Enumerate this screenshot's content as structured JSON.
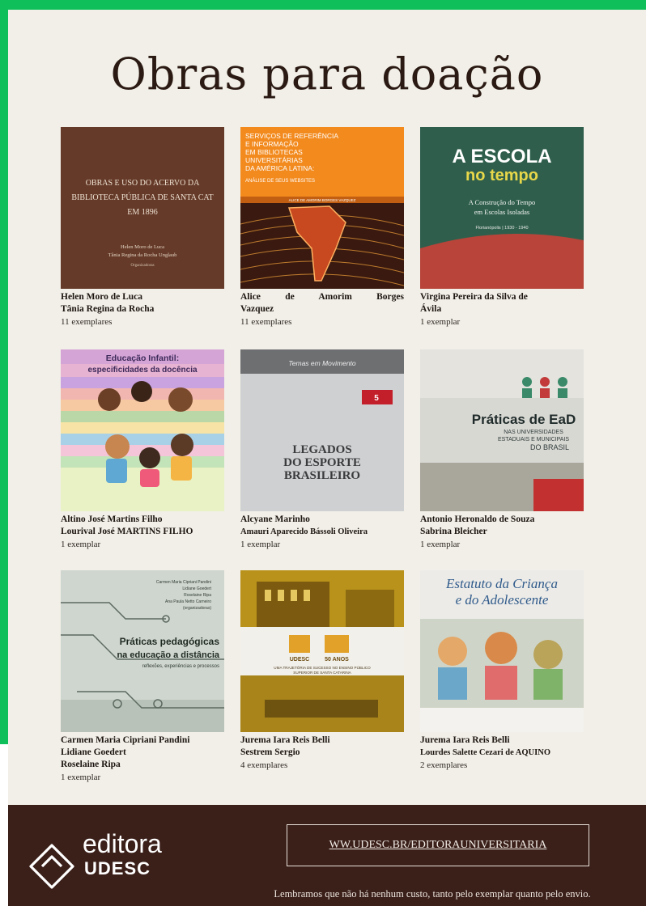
{
  "title": "Obras para doação",
  "books": [
    {
      "cover_text": [
        "OBRAS E USO DO ACERVO DA",
        "BIBLIOTECA PÚBLICA DE SANTA CAT",
        "EM 1896",
        "Helen Moro de Luca",
        "Tânia Regina da Rocha Unglaub",
        "Organizadoras"
      ],
      "authors": [
        "Helen Moro de Luca",
        "Tânia Regina da Rocha"
      ],
      "count": "11 exemplares"
    },
    {
      "cover_text": [
        "SERVIÇOS DE REFERÊNCIA",
        "E INFORMAÇÃO",
        "EM BIBLIOTECAS",
        "UNIVERSITÁRIAS",
        "DA AMÉRICA LATINA:",
        "ANÁLISE DE SEUS WEBSITES",
        "ALICE DE AMORIM BORGES VAZQUEZ"
      ],
      "authors": [
        "Alice de Amorim Borges",
        "Vazquez"
      ],
      "count": "11 exemplares"
    },
    {
      "cover_text": [
        "A ESCOLA",
        "no tempo",
        "A Construção do Tempo",
        "em Escolas Isoladas",
        "Florianópolis | 1930 - 1940"
      ],
      "authors": [
        "Virgina Pereira da Silva de",
        "Ávila"
      ],
      "count": "1 exemplar"
    },
    {
      "cover_text": [
        "Educação Infantil:",
        "especificidades da docência"
      ],
      "authors": [
        "Altino José Martins Filho",
        "Lourival José MARTINS FILHO"
      ],
      "count": "1 exemplar"
    },
    {
      "cover_text": [
        "Temas em Movimento",
        "5",
        "LEGADOS",
        "DO ESPORTE",
        "BRASILEIRO"
      ],
      "authors": [
        "Alcyane Marinho",
        "Amauri Aparecido Bássoli Oliveira"
      ],
      "count": "1 exemplar"
    },
    {
      "cover_text": [
        "Práticas de EaD",
        "NAS UNIVERSIDADES",
        "ESTADUAIS E MUNICIPAIS",
        "DO BRASIL"
      ],
      "authors": [
        "Antonio Heronaldo de Souza",
        "Sabrina Bleicher"
      ],
      "count": "1 exemplar"
    },
    {
      "cover_text": [
        "Carmen Maria Cipriani Pandini",
        "Lidiane Goedert",
        "Roselaine Ripa",
        "Ana Paula Netto Carneiro",
        "(organizadoras)",
        "Práticas pedagógicas",
        "na educação a distância",
        "reflexões, experiências e processos"
      ],
      "authors": [
        "Carmen Maria Cipriani Pandini",
        "Lidiane Goedert",
        "Roselaine Ripa"
      ],
      "count": "1 exemplar"
    },
    {
      "cover_text": [
        "UDESC",
        "50 ANOS",
        "UMA TRAJETÓRIA DE SUCESSO NO ENSINO PÚBLICO",
        "SUPERIOR DE SANTA CATARINA"
      ],
      "authors": [
        "Jurema Iara Reis Belli",
        "Sestrem Sergio"
      ],
      "count": "4 exemplares"
    },
    {
      "cover_text": [
        "Estatuto da Criança",
        "e do Adolescente"
      ],
      "authors": [
        "Jurema Iara Reis Belli",
        "Lourdes Salette Cezari de AQUINO"
      ],
      "count": "2 exemplares"
    }
  ],
  "footer": {
    "logo_line1": "editora",
    "logo_line2": "UDESC",
    "url": "WW.UDESC.BR/EDITORAUNIVERSITARIA",
    "note": "Lembramos que não há nenhum custo, tanto pelo exemplar quanto pelo envio."
  },
  "colors": {
    "accent_green": "#0fbf5a",
    "poster_bg": "#f1efe7",
    "footer_bg": "#3b201a"
  }
}
